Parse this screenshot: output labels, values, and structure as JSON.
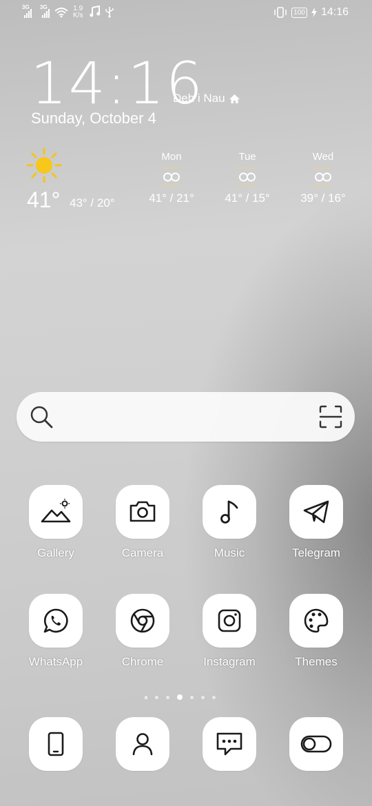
{
  "status_bar": {
    "left": {
      "net1": "3G",
      "net2": "3G",
      "speed_value": "1.9",
      "speed_unit": "K/s"
    },
    "right": {
      "battery": "100",
      "time": "14:16"
    },
    "icons": [
      "signal-icon",
      "signal-icon",
      "wifi-icon",
      "music-note-icon",
      "usb-icon",
      "vibrate-icon",
      "battery-icon",
      "charging-icon"
    ]
  },
  "clock": {
    "time": "14:16",
    "location": "Deh i Nau",
    "date": "Sunday, October 4"
  },
  "weather": {
    "current_temp": "41°",
    "today_range": "43° / 20°",
    "forecast": [
      {
        "day": "Mon",
        "range": "41° / 21°"
      },
      {
        "day": "Tue",
        "range": "41° / 15°"
      },
      {
        "day": "Wed",
        "range": "39° / 16°"
      }
    ]
  },
  "apps_row1": [
    {
      "label": "Gallery",
      "icon": "gallery-icon"
    },
    {
      "label": "Camera",
      "icon": "camera-icon"
    },
    {
      "label": "Music",
      "icon": "music-icon"
    },
    {
      "label": "Telegram",
      "icon": "telegram-icon"
    }
  ],
  "apps_row2": [
    {
      "label": "WhatsApp",
      "icon": "whatsapp-icon"
    },
    {
      "label": "Chrome",
      "icon": "chrome-icon"
    },
    {
      "label": "Instagram",
      "icon": "instagram-icon"
    },
    {
      "label": "Themes",
      "icon": "themes-icon"
    }
  ],
  "page_indicator": {
    "count": 7,
    "active": 4
  },
  "dock": [
    {
      "icon": "phone-icon"
    },
    {
      "icon": "contacts-icon"
    },
    {
      "icon": "messages-icon"
    },
    {
      "icon": "toggle-icon"
    }
  ],
  "colors": {
    "icon_tile": "#ffffff",
    "icon_glyph": "#1a1a1a",
    "sun": "#f5c518"
  }
}
